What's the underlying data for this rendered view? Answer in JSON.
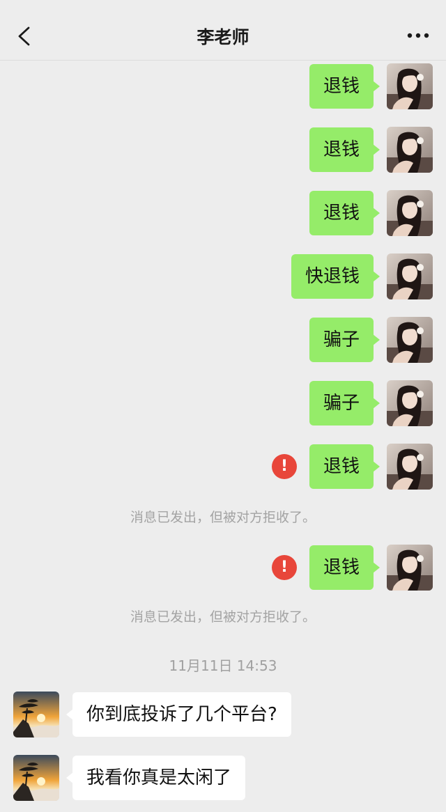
{
  "header": {
    "title": "李老师",
    "back_icon": "chevron-left-icon",
    "more_icon": "more-dots-icon"
  },
  "messages": [
    {
      "text": "退钱"
    },
    {
      "text": "退钱"
    },
    {
      "text": "退钱"
    },
    {
      "text": "快退钱"
    },
    {
      "text": "骗子"
    },
    {
      "text": "骗子"
    },
    {
      "text": "退钱"
    },
    {
      "text": "退钱"
    },
    {
      "text": "你到底投诉了几个平台?"
    },
    {
      "text": "我看你真是太闲了"
    }
  ],
  "error_mark": "!",
  "system_notes": [
    "消息已发出，但被对方拒收了。",
    "消息已发出，但被对方拒收了。"
  ],
  "timestamp": "11月11日 14:53",
  "colors": {
    "my_bubble": "#95ec69",
    "their_bubble": "#ffffff",
    "error": "#e8463a",
    "background": "#ededed"
  }
}
